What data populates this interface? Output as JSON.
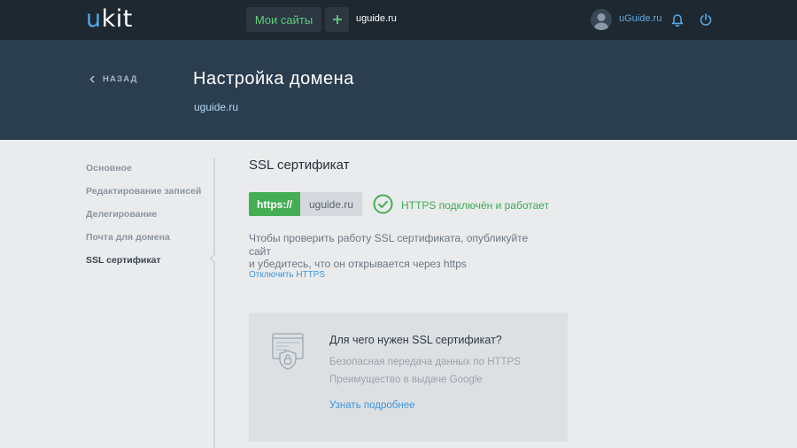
{
  "topbar": {
    "logo_u": "u",
    "logo_rest": "kit",
    "my_sites_label": "Мои сайты",
    "plus_icon": "plus-icon",
    "site_link": "uguide.ru",
    "user_name": "uGuide.ru",
    "icons": [
      "avatar-icon",
      "bell-icon",
      "power-icon"
    ]
  },
  "header": {
    "back_label": "НАЗАД",
    "title": "Настройка домена",
    "subtitle": "uguide.ru"
  },
  "sidebar": {
    "items": [
      {
        "label": "Основное"
      },
      {
        "label": "Редактирование записей"
      },
      {
        "label": "Делегирование"
      },
      {
        "label": "Почта для домена"
      },
      {
        "label": "SSL сертификат",
        "active": true
      }
    ]
  },
  "main": {
    "section_title": "SSL сертификат",
    "https_prefix": "https://",
    "domain": "uguide.ru",
    "status_text": "HTTPS подключён и работает",
    "description_line1": "Чтобы проверить работу SSL сертификата, опубликуйте сайт",
    "description_line2": "и убедитесь, что он открывается через https",
    "disable_link": "Отключить HTTPS"
  },
  "info_card": {
    "title": "Для чего нужен SSL сертификат?",
    "line1": "Безопасная передача данных по HTTPS",
    "line2": "Преимущество в выдаче Google",
    "link": "Узнать подробнее"
  },
  "colors": {
    "topbar_bg": "#1e2831",
    "header_bg": "#2b3e50",
    "page_bg": "#e9ebed",
    "accent_green": "#44ae54",
    "link_blue": "#3f95d9"
  }
}
